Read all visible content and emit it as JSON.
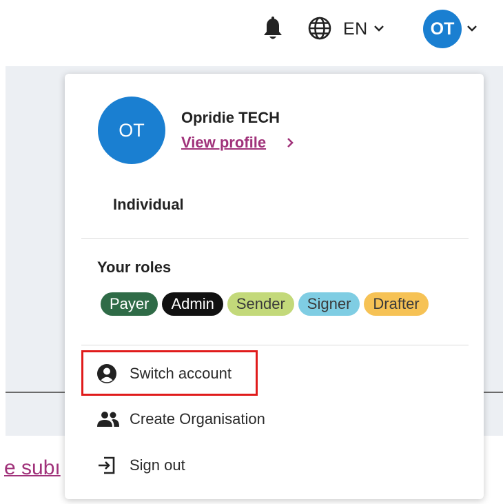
{
  "header": {
    "language": "EN",
    "avatar_initials": "OT"
  },
  "background": {
    "link_text": "e subı"
  },
  "profile_menu": {
    "avatar_initials": "OT",
    "user_name": "Opridie TECH",
    "view_profile_label": "View profile",
    "account_type": "Individual",
    "roles_heading": "Your roles",
    "roles": [
      {
        "label": "Payer",
        "bg": "#2f6b47",
        "fg": "#ffffff"
      },
      {
        "label": "Admin",
        "bg": "#111111",
        "fg": "#ffffff"
      },
      {
        "label": "Sender",
        "bg": "#c3d97a",
        "fg": "#3a3a3a"
      },
      {
        "label": "Signer",
        "bg": "#7fcde3",
        "fg": "#3a3a3a"
      },
      {
        "label": "Drafter",
        "bg": "#f6c255",
        "fg": "#3a3a3a"
      }
    ],
    "items": [
      {
        "label": "Switch account",
        "icon": "account-circle-icon"
      },
      {
        "label": "Create Organisation",
        "icon": "group-icon"
      },
      {
        "label": "Sign out",
        "icon": "sign-out-icon"
      }
    ]
  },
  "colors": {
    "avatar": "#1a7fd1",
    "link": "#a0327a",
    "highlight": "#e01b1b"
  }
}
